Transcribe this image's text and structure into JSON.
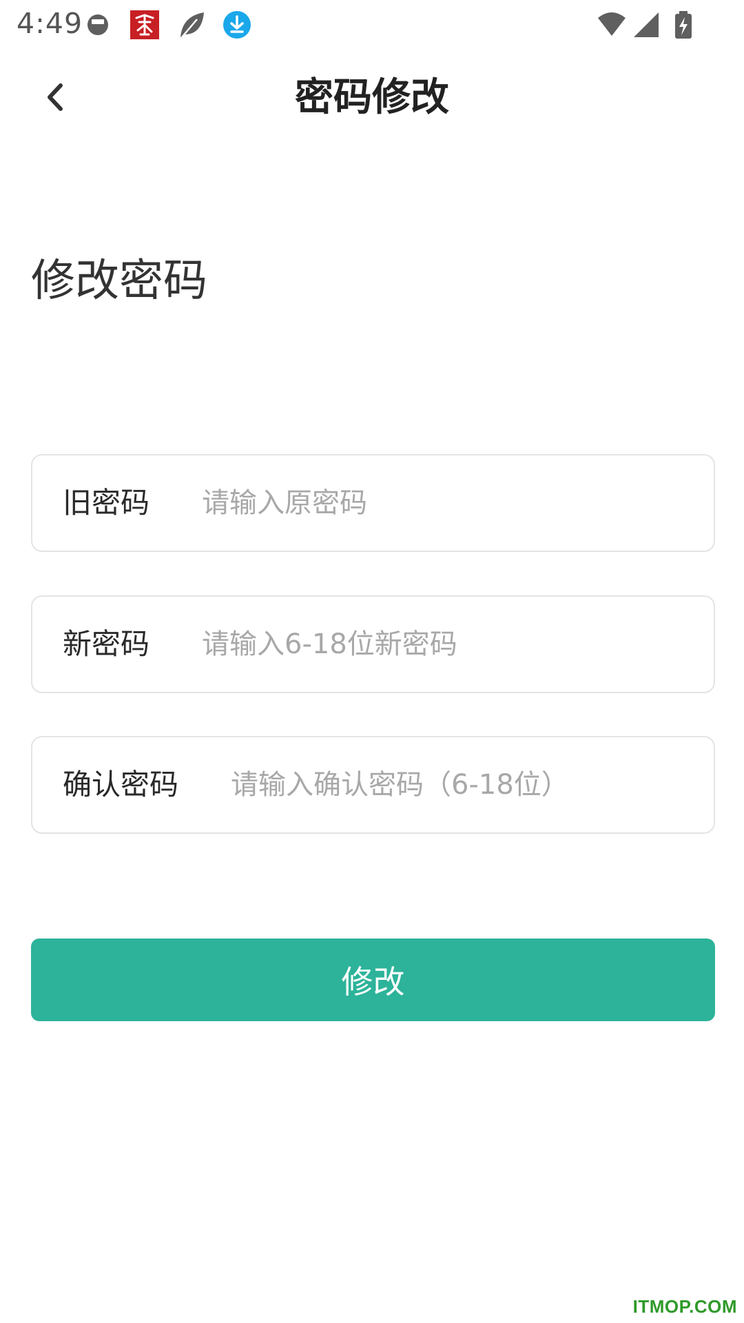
{
  "status_bar": {
    "time": "4:49",
    "icons": [
      "dnd-icon",
      "app-notification-icon",
      "leaf-icon",
      "download-icon",
      "wifi-icon",
      "cellular-signal-icon",
      "battery-charging-icon"
    ]
  },
  "header": {
    "title": "密码修改",
    "back_icon": "chevron-left-icon"
  },
  "section_heading": "修改密码",
  "form": {
    "old_password": {
      "label": "旧密码",
      "placeholder": "请输入原密码",
      "value": ""
    },
    "new_password": {
      "label": "新密码",
      "placeholder": "请输入6-18位新密码",
      "value": ""
    },
    "confirm_password": {
      "label": "确认密码",
      "placeholder": "请输入确认密码（6-18位）",
      "value": ""
    }
  },
  "submit_label": "修改",
  "watermark": "ITMOP.COM",
  "colors": {
    "accent": "#2db39a",
    "border": "#e4e4e4",
    "placeholder": "#a8a8a8",
    "watermark": "#2f9a2a"
  }
}
